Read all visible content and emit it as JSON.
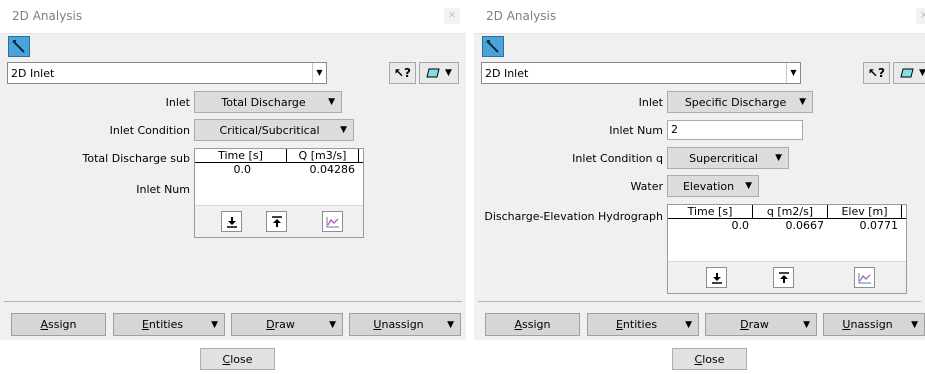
{
  "left": {
    "title": "2D Analysis",
    "analysis_select": "2D Inlet",
    "fields": {
      "inlet_label": "Inlet",
      "inlet_value": "Total Discharge",
      "inlet_condition_label": "Inlet Condition",
      "inlet_condition_value": "Critical/Subcritical",
      "hydrograph_label": "Total Discharge sub",
      "inlet_num_label": "Inlet Num"
    },
    "grid": {
      "columns": [
        "Time [s]",
        "Q [m3/s]"
      ],
      "rows": [
        [
          "0.0",
          "0.04286"
        ]
      ]
    },
    "buttons": {
      "assign_pre": "",
      "assign_acc": "A",
      "assign_post": "ssign",
      "entities_pre": "",
      "entities_acc": "E",
      "entities_post": "ntities",
      "draw_pre": "",
      "draw_acc": "D",
      "draw_post": "raw",
      "unassign_pre": "",
      "unassign_acc": "U",
      "unassign_post": "nassign",
      "close_pre": "",
      "close_acc": "C",
      "close_post": "lose"
    }
  },
  "right": {
    "title": "2D Analysis",
    "analysis_select": "2D Inlet",
    "fields": {
      "inlet_label": "Inlet",
      "inlet_value": "Specific Discharge",
      "inlet_num_label": "Inlet Num",
      "inlet_num_value": "2",
      "inlet_condition_label": "Inlet Condition q",
      "inlet_condition_value": "Supercritical",
      "water_label": "Water",
      "water_value": "Elevation",
      "hydrograph_label": "Discharge-Elevation Hydrograph"
    },
    "grid": {
      "columns": [
        "Time [s]",
        "q [m2/s]",
        "Elev [m]"
      ],
      "rows": [
        [
          "0.0",
          "0.0667",
          "0.0771"
        ]
      ]
    },
    "buttons": {
      "assign_pre": "",
      "assign_acc": "A",
      "assign_post": "ssign",
      "entities_pre": "",
      "entities_acc": "E",
      "entities_post": "ntities",
      "draw_pre": "",
      "draw_acc": "D",
      "draw_post": "raw",
      "unassign_pre": "",
      "unassign_acc": "U",
      "unassign_post": "nassign",
      "close_pre": "",
      "close_acc": "C",
      "close_post": "lose"
    }
  },
  "icons": {
    "tool": "pencil-tool-icon",
    "help": "whats-this-help-icon",
    "layer": "layer-icon",
    "export": "download-icon",
    "import": "upload-icon",
    "plot": "graph-icon"
  },
  "colors": {
    "panel_bg": "#f0f0f0",
    "title_text": "#808080",
    "tool_button": "#4aa3d9",
    "accent_line": "#3a7bd5"
  }
}
